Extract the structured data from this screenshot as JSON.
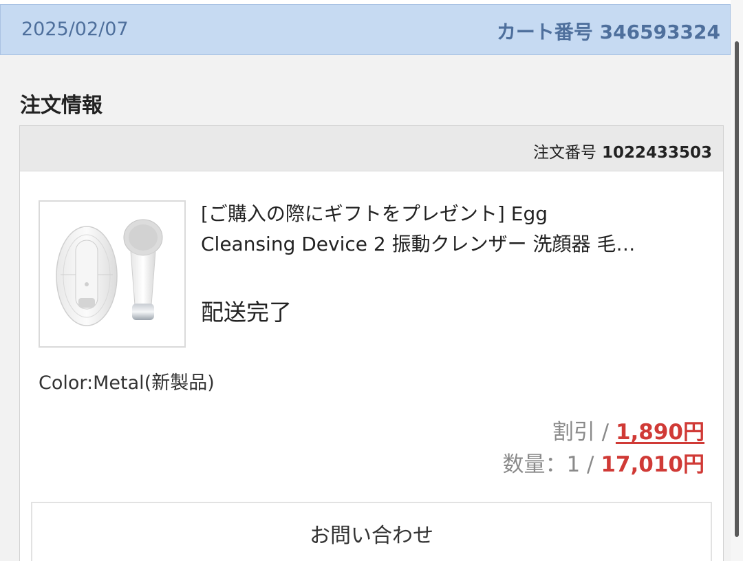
{
  "header": {
    "date": "2025/02/07",
    "cart_label": "カート番号",
    "cart_number": "346593324"
  },
  "section": {
    "title": "注文情報"
  },
  "order": {
    "number_label": "注文番号",
    "number": "1022433503",
    "product": {
      "name_line1": "[ご購入の際にギフトをプレゼント] Egg",
      "name_line2": "Cleansing Device 2 振動クレンザー 洗顔器 毛…",
      "status": "配送完了",
      "variation": "Color:Metal(新製品)",
      "discount_label": "割引 / ",
      "discount_amount": "1,890円",
      "quantity_label": "数量：1 / ",
      "price": "17,010円",
      "image_icon": "product-photo-cleansing-device"
    },
    "inquiry_button": "お問い合わせ"
  },
  "colors": {
    "header_bg": "#c6daf2",
    "header_text": "#4e6f9c",
    "price_red": "#d03a36"
  }
}
